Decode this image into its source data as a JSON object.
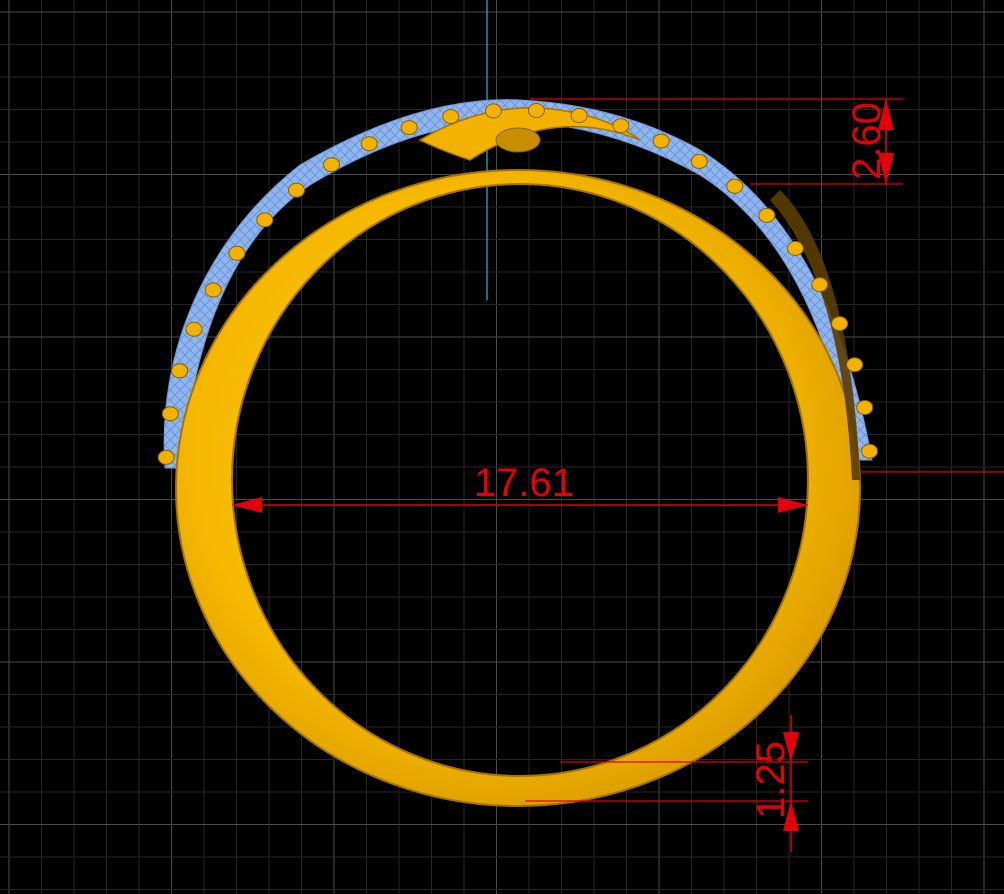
{
  "viewport": {
    "background_color": "#000000",
    "grid": {
      "shown": true,
      "minor_color": "#262626",
      "major_color": "#4a4a4a"
    },
    "axis_color": "#2fb6c8"
  },
  "model": {
    "name": "ring",
    "metal_color": "#f6b800",
    "metal_shadow_color": "#b57d00",
    "stone_color": "#8fb6ef"
  },
  "dimensions": {
    "color": "#e3000b",
    "inner_diameter": "17.61",
    "band_top_height": "2.60",
    "band_bottom_thickness": "1.25"
  }
}
